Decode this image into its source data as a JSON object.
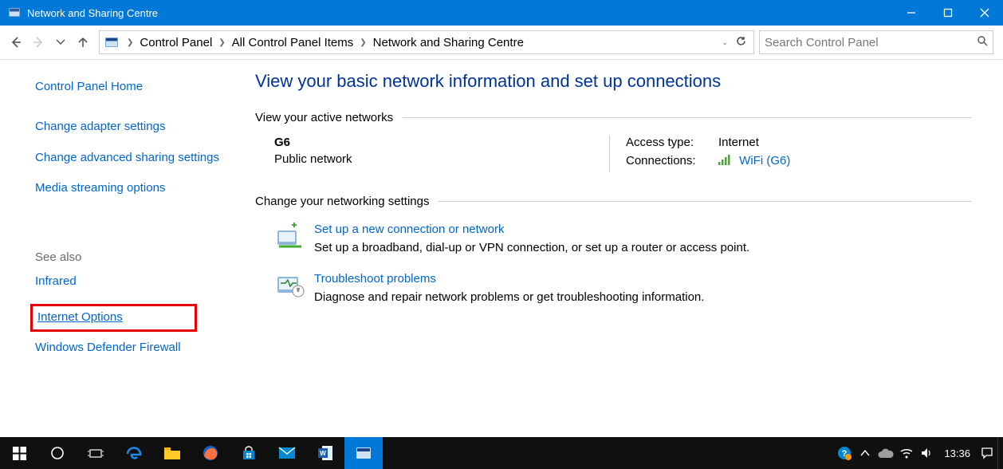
{
  "window": {
    "title": "Network and Sharing Centre"
  },
  "address": {
    "crumbs": [
      "Control Panel",
      "All Control Panel Items",
      "Network and Sharing Centre"
    ]
  },
  "search": {
    "placeholder": "Search Control Panel"
  },
  "sidebar": {
    "home": "Control Panel Home",
    "links": [
      "Change adapter settings",
      "Change advanced sharing settings",
      "Media streaming options"
    ],
    "see_also_header": "See also",
    "see_also": {
      "infrared": "Infrared",
      "internet_options": "Internet Options",
      "firewall": "Windows Defender Firewall"
    }
  },
  "main": {
    "heading": "View your basic network information and set up connections",
    "active_networks_label": "View your active networks",
    "network": {
      "name": "G6",
      "category": "Public network",
      "access_type_label": "Access type:",
      "access_type_value": "Internet",
      "connections_label": "Connections:",
      "connection_link": "WiFi (G6)"
    },
    "change_settings_label": "Change your networking settings",
    "tasks": [
      {
        "title": "Set up a new connection or network",
        "desc": "Set up a broadband, dial-up or VPN connection, or set up a router or access point."
      },
      {
        "title": "Troubleshoot problems",
        "desc": "Diagnose and repair network problems or get troubleshooting information."
      }
    ]
  },
  "taskbar": {
    "clock": "13:36"
  }
}
